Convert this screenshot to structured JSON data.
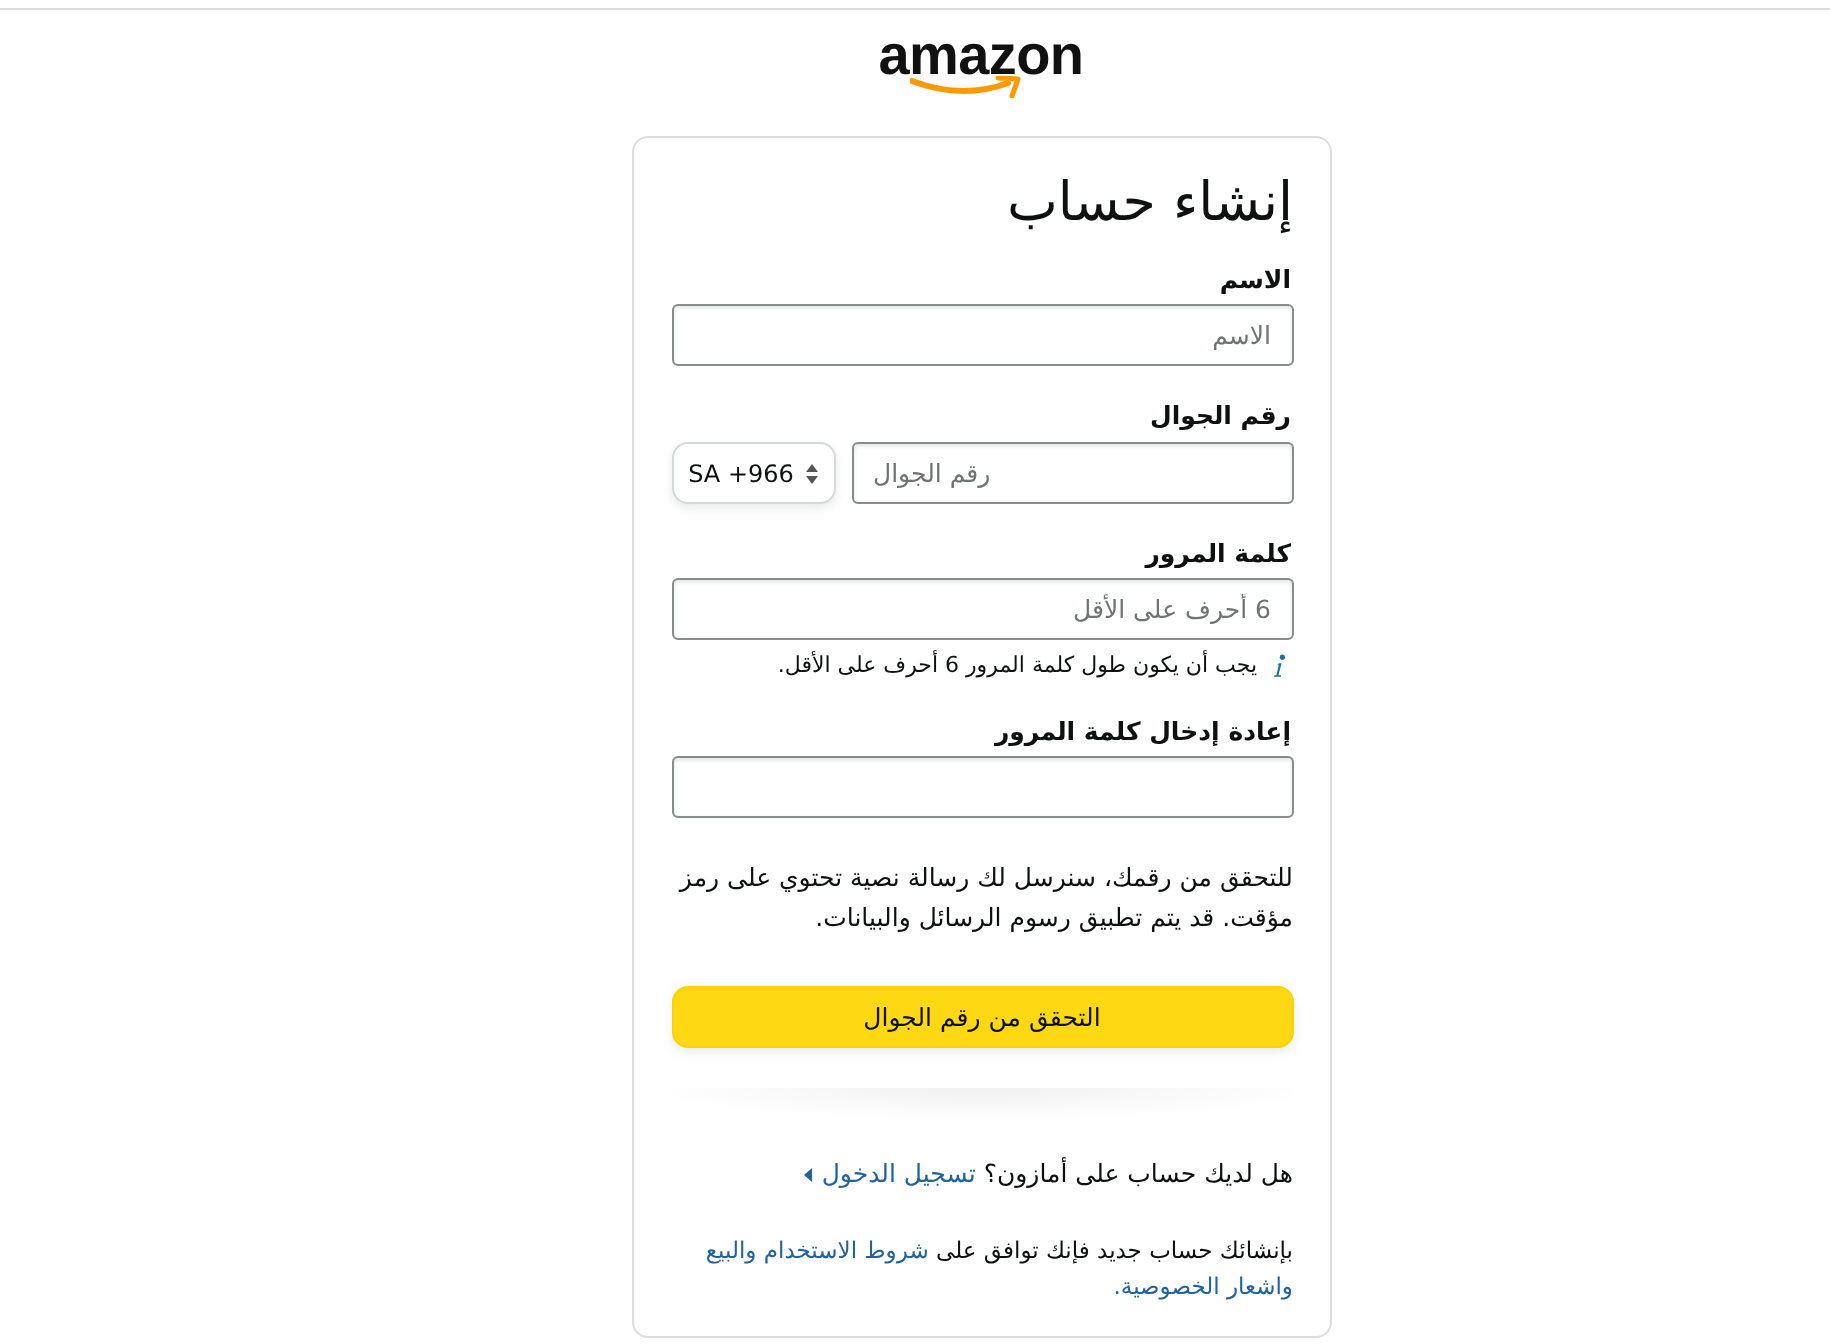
{
  "header": {
    "logo_text": "amazon"
  },
  "form": {
    "title": "إنشاء حساب",
    "fields": [
      {
        "kind": "text",
        "label": "الاسم",
        "placeholder": "الاسم"
      },
      {
        "kind": "phone",
        "label": "رقم الجوال",
        "country_code": "SA +966",
        "placeholder": "رقم الجوال"
      },
      {
        "kind": "password",
        "label": "كلمة المرور",
        "placeholder": "6 أحرف على الأقل",
        "hint": "يجب أن يكون طول كلمة المرور 6 أحرف على الأقل."
      },
      {
        "kind": "password",
        "label": "إعادة إدخال كلمة المرور"
      }
    ],
    "notice": "للتحقق من رقمك، سنرسل لك رسالة نصية تحتوي على رمز مؤقت. قد يتم تطبيق رسوم الرسائل والبيانات.",
    "submit_button": "التحقق من رقم الجوال"
  },
  "signin": {
    "question": "هل لديك حساب على أمازون؟",
    "link": "تسجيل الدخول"
  },
  "terms": {
    "text": "بإنشائك حساب جديد فإنك توافق على",
    "links": [
      "شروط الاستخدام والبيع",
      "واشعار الخصوصية."
    ]
  }
}
